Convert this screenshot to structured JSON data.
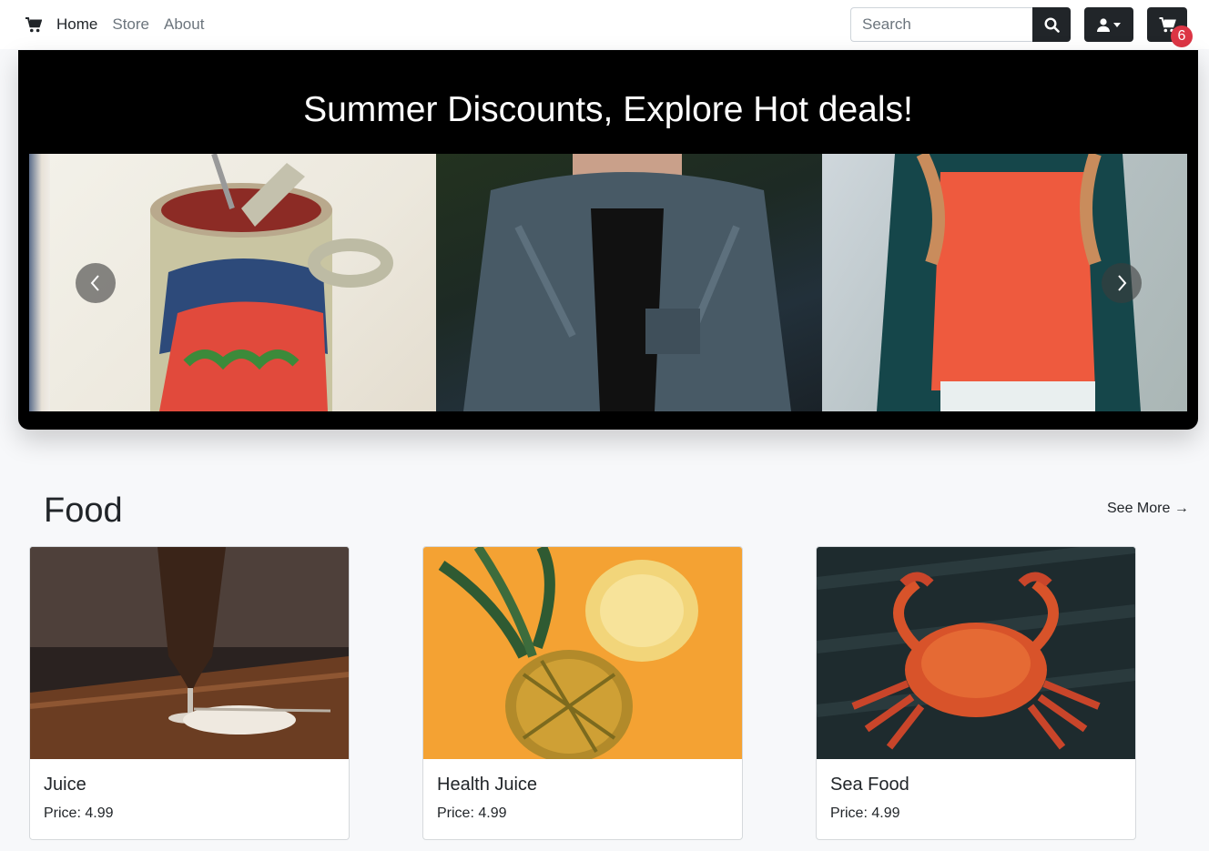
{
  "nav": {
    "links": [
      "Home",
      "Store",
      "About"
    ],
    "search_placeholder": "Search",
    "cart_count": "6"
  },
  "hero": {
    "title": "Summer Discounts, Explore Hot deals!",
    "slides": [
      "tomato-paste-can",
      "denim-jacket",
      "red-blouse-jacket"
    ]
  },
  "section": {
    "title": "Food",
    "see_more": "See More →"
  },
  "products": [
    {
      "name": "Juice",
      "price": "Price: 4.99",
      "image": "juice-glass"
    },
    {
      "name": "Health Juice",
      "price": "Price: 4.99",
      "image": "pineapple"
    },
    {
      "name": "Sea Food",
      "price": "Price: 4.99",
      "image": "crab"
    }
  ],
  "colors": {
    "navbar_bg": "#ffffff",
    "dark_button": "#212529",
    "badge": "#dc3545",
    "page_bg": "#f7f8fa",
    "hero_bg": "#000000"
  }
}
